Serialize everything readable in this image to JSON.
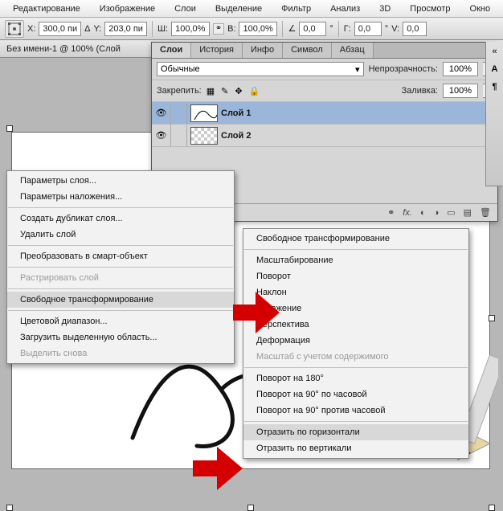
{
  "menubar": [
    "Редактирование",
    "Изображение",
    "Слои",
    "Выделение",
    "Фильтр",
    "Анализ",
    "3D",
    "Просмотр",
    "Окно"
  ],
  "options": {
    "x_lbl": "X:",
    "x_val": "300,0 пи",
    "y_lbl": "Y:",
    "y_val": "203,0 пи",
    "w_lbl": "Ш:",
    "w_val": "100,0%",
    "h_lbl": "В:",
    "h_val": "100,0%",
    "ang_lbl": "",
    "ang_val": "0,0",
    "unit": "°",
    "shear_g": "Г:",
    "shear_g_val": "0,0",
    "shear_v": "V:",
    "shear_v_val": "0,0",
    "delta": "Δ"
  },
  "doc_tab": "Без имени-1 @ 100% (Слой",
  "panel": {
    "tabs": [
      "Слои",
      "История",
      "Инфо",
      "Символ",
      "Абзац"
    ],
    "mode": "Обычные",
    "opacity_lbl": "Непрозрачность:",
    "opacity_val": "100%",
    "lock_lbl": "Закрепить:",
    "fill_lbl": "Заливка:",
    "fill_val": "100%",
    "layers": [
      {
        "name": "Слой 1",
        "selected": true,
        "checker": false
      },
      {
        "name": "Слой 2",
        "selected": false,
        "checker": true
      }
    ]
  },
  "ctx1": {
    "items": [
      {
        "t": "Параметры слоя...",
        "d": false
      },
      {
        "t": "Параметры наложения...",
        "d": false
      },
      {
        "sep": true
      },
      {
        "t": "Создать дубликат слоя...",
        "d": false
      },
      {
        "t": "Удалить слой",
        "d": false
      },
      {
        "sep": true
      },
      {
        "t": "Преобразовать в смарт-объект",
        "d": false
      },
      {
        "sep": true
      },
      {
        "t": "Растрировать слой",
        "d": true
      },
      {
        "sep": true
      },
      {
        "t": "Свободное трансформирование",
        "d": false,
        "hl": true
      },
      {
        "sep": true
      },
      {
        "t": "Цветовой диапазон...",
        "d": false
      },
      {
        "t": "Загрузить выделенную область...",
        "d": false
      },
      {
        "t": "Выделить снова",
        "d": true
      }
    ]
  },
  "ctx2": {
    "items": [
      {
        "t": "Свободное трансформирование",
        "d": false
      },
      {
        "sep": true
      },
      {
        "t": "Масштабирование",
        "d": false
      },
      {
        "t": "Поворот",
        "d": false
      },
      {
        "t": "Наклон",
        "d": false
      },
      {
        "t": "Искажение",
        "d": false
      },
      {
        "t": "Перспектива",
        "d": false
      },
      {
        "t": "Деформация",
        "d": false
      },
      {
        "t": "Масштаб с учетом содержимого",
        "d": true
      },
      {
        "sep": true
      },
      {
        "t": "Поворот на 180°",
        "d": false
      },
      {
        "t": "Поворот на 90° по часовой",
        "d": false
      },
      {
        "t": "Поворот на 90° против часовой",
        "d": false
      },
      {
        "sep": true
      },
      {
        "t": "Отразить по горизонтали",
        "d": false,
        "hl": true
      },
      {
        "t": "Отразить по вертикали",
        "d": false
      }
    ]
  }
}
